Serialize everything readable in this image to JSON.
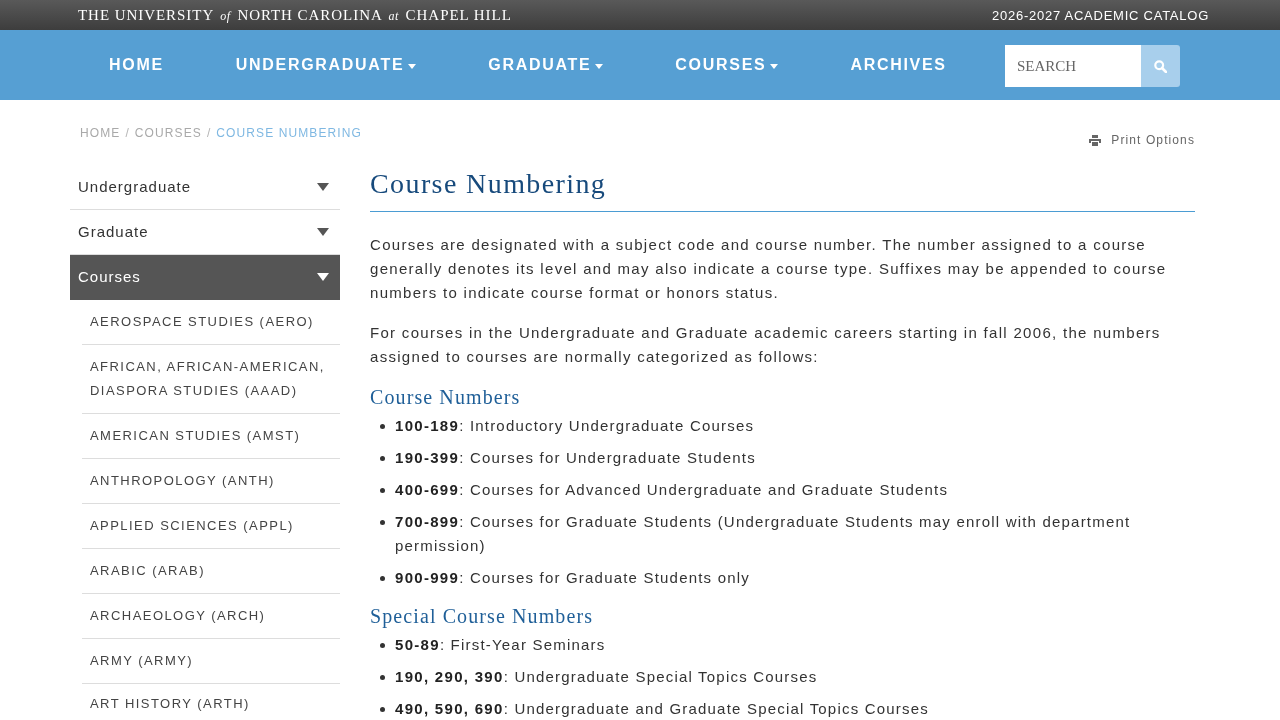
{
  "top_bar": {
    "university": "THE UNIVERSITY *of* NORTH CAROLINA *at* CHAPEL HILL",
    "catalog": "2026-2027 ACADEMIC CATALOG"
  },
  "nav": {
    "items": [
      {
        "label": "HOME",
        "dropdown": false
      },
      {
        "label": "UNDERGRADUATE",
        "dropdown": true
      },
      {
        "label": "GRADUATE",
        "dropdown": true
      },
      {
        "label": "COURSES",
        "dropdown": true
      },
      {
        "label": "ARCHIVES",
        "dropdown": false
      }
    ],
    "search": {
      "placeholder": "SEARCH"
    }
  },
  "breadcrumb": [
    {
      "kind": "link",
      "label": "HOME"
    },
    {
      "kind": "separator",
      "label": "/"
    },
    {
      "kind": "link",
      "label": "COURSES"
    },
    {
      "kind": "separator",
      "label": "/"
    },
    {
      "kind": "current",
      "label": "COURSE NUMBERING"
    }
  ],
  "print_options": {
    "label": "Print Options"
  },
  "sidebar": {
    "items": [
      {
        "label": "Undergraduate",
        "selected": false
      },
      {
        "label": "Graduate",
        "selected": false
      },
      {
        "label": "Courses",
        "selected": true,
        "children": [
          {
            "label": "AEROSPACE STUDIES (AERO)",
            "selected": false
          },
          {
            "label": "AFRICAN, AFRICAN-AMERICAN, DIASPORA STUDIES (AAAD)",
            "selected": false
          },
          {
            "label": "AMERICAN STUDIES (AMST)",
            "selected": false
          },
          {
            "label": "ANTHROPOLOGY (ANTH)",
            "selected": false
          },
          {
            "label": "APPLIED SCIENCES (APPL)",
            "selected": false
          },
          {
            "label": "ARABIC (ARAB)",
            "selected": false
          },
          {
            "label": "ARCHAEOLOGY (ARCH)",
            "selected": false
          },
          {
            "label": "ARMY (ARMY)",
            "selected": false
          },
          {
            "label": "ART HISTORY (ARTH)",
            "selected": false
          }
        ]
      }
    ]
  },
  "content": {
    "title": "Course Numbering",
    "blocks": [
      {
        "kind": "paragraph",
        "text": "Courses are designated with a subject code and course number. The number assigned to a course generally denotes its level and may also indicate a course type. Suffixes may be appended to course numbers to indicate course format or honors status."
      },
      {
        "kind": "paragraph",
        "text": "For courses in the Undergraduate and Graduate academic careers starting in fall 2006, the numbers assigned to courses are normally categorized as follows:"
      },
      {
        "kind": "heading",
        "text": "Course Numbers"
      },
      {
        "kind": "list",
        "items": [
          "**100-189**: Introductory Undergraduate Courses",
          "**190-399**: Courses for Undergraduate Students",
          "**400-699**: Courses for Advanced Undergraduate and Graduate Students",
          "**700-899**: Courses for Graduate Students (Undergraduate Students may enroll with department permission)",
          "**900-999**: Courses for Graduate Students only"
        ]
      },
      {
        "kind": "heading",
        "text": "Special Course Numbers"
      },
      {
        "kind": "list",
        "items": [
          "**50-89**: First-Year Seminars",
          "**190, 290, 390**: Undergraduate Special Topics Courses",
          "**490, 590, 690**: Undergraduate and Graduate Special Topics Courses"
        ]
      }
    ]
  }
}
